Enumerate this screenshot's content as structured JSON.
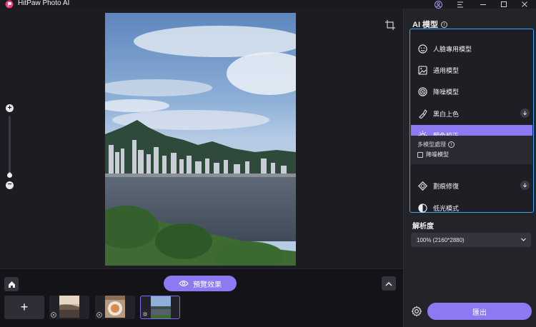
{
  "app": {
    "title": "HitPaw Photo AI"
  },
  "colors": {
    "accent": "#8d79f1",
    "highlight_border": "#3aa6ff",
    "panel_bg": "#23232a",
    "canvas_bg": "#1c1c22"
  },
  "titlebar_icons": [
    "account-icon",
    "menu-icon",
    "minimize-icon",
    "maximize-icon",
    "close-icon"
  ],
  "canvas": {
    "crop_icon": "crop-icon",
    "zoom_in": "+",
    "zoom_out": "−",
    "zoom_level": 0.08
  },
  "bottom": {
    "preview_label": "預覽效果",
    "add_label": "+",
    "thumbnails": [
      {
        "name": "thumb-sunset",
        "selected": false
      },
      {
        "name": "thumb-food",
        "selected": false
      },
      {
        "name": "thumb-harbour",
        "selected": true
      }
    ]
  },
  "panel": {
    "title": "AI 模型",
    "models": [
      {
        "id": "face",
        "label": "人臉專用模型",
        "icon": "face-icon",
        "active": false,
        "download": false
      },
      {
        "id": "general",
        "label": "通用模型",
        "icon": "image-icon",
        "active": false,
        "download": false
      },
      {
        "id": "denoise",
        "label": "降噪模型",
        "icon": "denoise-icon",
        "active": false,
        "download": false
      },
      {
        "id": "colorize",
        "label": "黑白上色",
        "icon": "brush-icon",
        "active": false,
        "download": true
      },
      {
        "id": "color-calibrate",
        "label": "顏色校正",
        "icon": "sun-icon",
        "active": true,
        "download": false
      },
      {
        "id": "scratch-repair",
        "label": "劃痕修復",
        "icon": "patch-icon",
        "active": false,
        "download": true
      },
      {
        "id": "low-light",
        "label": "低光模式",
        "icon": "contrast-icon",
        "active": false,
        "download": false
      }
    ],
    "multi_model": {
      "label": "多模型處理",
      "option": "降噪模型"
    },
    "resolution": {
      "title": "解析度",
      "value": "100% (2160*2880)"
    },
    "export_label": "匯出"
  }
}
